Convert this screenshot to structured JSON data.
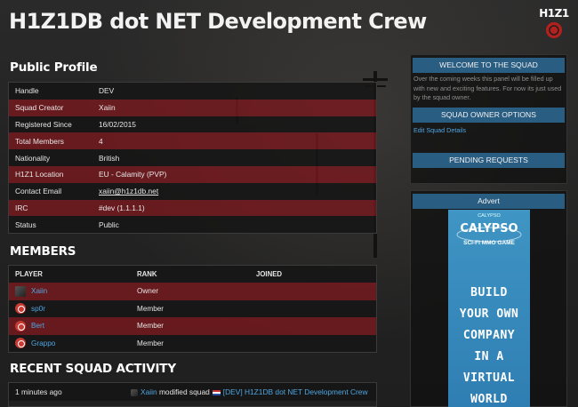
{
  "header": {
    "site_title": "H1Z1DB dot NET Development Crew",
    "logo_text": "H1Z1"
  },
  "profile": {
    "title": "Public Profile",
    "rows": [
      {
        "key": "Handle",
        "value": "DEV"
      },
      {
        "key": "Squad Creator",
        "value": "Xaiin"
      },
      {
        "key": "Registered Since",
        "value": "16/02/2015"
      },
      {
        "key": "Total Members",
        "value": "4"
      },
      {
        "key": "Nationality",
        "value": "British"
      },
      {
        "key": "H1Z1 Location",
        "value": "EU - Calamity (PVP)"
      },
      {
        "key": "Contact Email",
        "value": "xaiin@h1z1db.net"
      },
      {
        "key": "IRC",
        "value": "#dev (1.1.1.1)"
      },
      {
        "key": "Status",
        "value": "Public"
      }
    ]
  },
  "members": {
    "title": "MEMBERS",
    "headers": [
      "PLAYER",
      "RANK",
      "JOINED"
    ],
    "rows": [
      {
        "player": "Xaiin",
        "rank": "Owner",
        "joined": ""
      },
      {
        "player": "sp0r",
        "rank": "Member",
        "joined": ""
      },
      {
        "player": "Bert",
        "rank": "Member",
        "joined": ""
      },
      {
        "player": "Grappo",
        "rank": "Member",
        "joined": ""
      }
    ]
  },
  "activity": {
    "title": "RECENT SQUAD ACTIVITY",
    "rows": [
      {
        "time": "1 minutes ago",
        "user": "Xaiin",
        "action": "modified squad",
        "target": "[DEV] H1Z1DB dot NET Development Crew"
      }
    ]
  },
  "sidebar": {
    "welcome_title": "WELCOME TO THE SQUAD",
    "welcome_text": "Over the coming weeks this panel will be filled up with new and exciting features. For now its just used by the squad owner.",
    "owner_title": "SQUAD OWNER OPTIONS",
    "edit_link": "Edit Squad Details",
    "pending_title": "PENDING REQUESTS",
    "advert_title": "Advert"
  },
  "ad": {
    "small": "CALYPSO",
    "logo": "CALYPSO",
    "sub": "SCI-FI MMO GAME",
    "lines": [
      "BUILD",
      "YOUR OWN",
      "COMPANY",
      "IN A VIRTUAL",
      "WORLD"
    ]
  },
  "colors": {
    "accent_blue": "#2a5d82",
    "row_red": "#7a1a1e",
    "link": "#4ea6e2"
  }
}
